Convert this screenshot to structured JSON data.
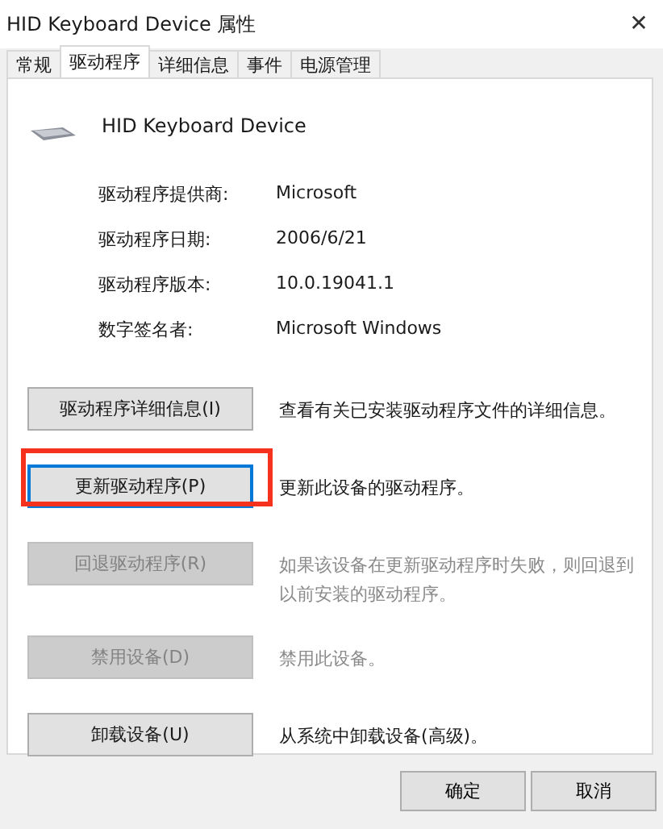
{
  "window": {
    "title": "HID Keyboard Device 属性",
    "close": "✕"
  },
  "tabs": [
    {
      "label": "常规",
      "selected": false
    },
    {
      "label": "驱动程序",
      "selected": true
    },
    {
      "label": "详细信息",
      "selected": false
    },
    {
      "label": "事件",
      "selected": false
    },
    {
      "label": "电源管理",
      "selected": false
    }
  ],
  "device": {
    "name": "HID Keyboard Device"
  },
  "properties": [
    {
      "label": "驱动程序提供商:",
      "value": "Microsoft"
    },
    {
      "label": "驱动程序日期:",
      "value": "2006/6/21"
    },
    {
      "label": "驱动程序版本:",
      "value": "10.0.19041.1"
    },
    {
      "label": "数字签名者:",
      "value": "Microsoft Windows"
    }
  ],
  "actions": [
    {
      "button": "驱动程序详细信息(I)",
      "description": "查看有关已安装驱动程序文件的详细信息。",
      "disabled": false,
      "highlighted": false
    },
    {
      "button": "更新驱动程序(P)",
      "description": "更新此设备的驱动程序。",
      "disabled": false,
      "highlighted": true
    },
    {
      "button": "回退驱动程序(R)",
      "description": "如果该设备在更新驱动程序时失败，则回退到以前安装的驱动程序。",
      "disabled": true,
      "highlighted": false
    },
    {
      "button": "禁用设备(D)",
      "description": "禁用此设备。",
      "disabled": true,
      "highlighted": false
    },
    {
      "button": "卸载设备(U)",
      "description": "从系统中卸载设备(高级)。",
      "disabled": false,
      "highlighted": false
    }
  ],
  "footer_buttons": [
    "确定",
    "取消"
  ]
}
